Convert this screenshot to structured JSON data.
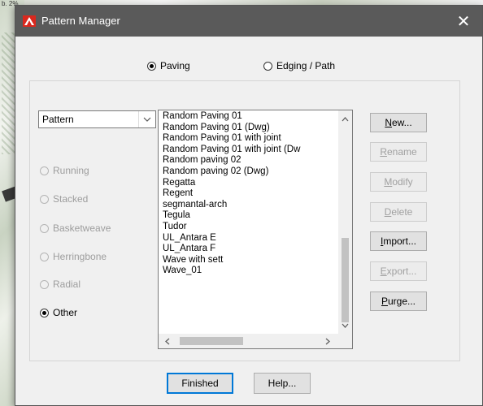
{
  "background": {
    "corner_text": "b. 2%"
  },
  "window": {
    "title": "Pattern Manager",
    "close_glyph": "✕"
  },
  "mode": {
    "paving_label": "Paving",
    "edging_label": "Edging / Path",
    "selected": "paving"
  },
  "pattern_type": {
    "selected": "Pattern"
  },
  "layouts": [
    {
      "label": "Running",
      "enabled": false,
      "checked": false
    },
    {
      "label": "Stacked",
      "enabled": false,
      "checked": false
    },
    {
      "label": "Basketweave",
      "enabled": false,
      "checked": false
    },
    {
      "label": "Herringbone",
      "enabled": false,
      "checked": false
    },
    {
      "label": "Radial",
      "enabled": false,
      "checked": false
    },
    {
      "label": "Other",
      "enabled": true,
      "checked": true
    }
  ],
  "patterns": [
    "Random Paving 01",
    "Random Paving 01  (Dwg)",
    "Random Paving 01 with joint",
    "Random Paving 01 with joint  (Dw",
    "Random paving 02",
    "Random paving 02  (Dwg)",
    "Regatta",
    "Regent",
    "segmantal-arch",
    "Tegula",
    "Tudor",
    "UL_Antara E",
    "UL_Antara F",
    "Wave with sett",
    "Wave_01"
  ],
  "side_buttons": [
    {
      "first": "N",
      "rest": "ew...",
      "enabled": true
    },
    {
      "first": "R",
      "rest": "ename",
      "enabled": false
    },
    {
      "first": "M",
      "rest": "odify",
      "enabled": false
    },
    {
      "first": "D",
      "rest": "elete",
      "enabled": false
    },
    {
      "first": "I",
      "rest": "mport...",
      "enabled": true
    },
    {
      "first": "E",
      "rest": "xport...",
      "enabled": false
    },
    {
      "first": "P",
      "rest": "urge...",
      "enabled": true
    }
  ],
  "footer": {
    "finished_label": "Finished",
    "help_label": "Help..."
  },
  "colors": {
    "titlebar": "#5a5a5a",
    "accent": "#0078d7",
    "icon_red": "#d9281e"
  },
  "icons": {
    "app": "app-logo-icon",
    "dropdown": "chevron-down-icon",
    "scroll_up": "scroll-up-icon",
    "scroll_down": "scroll-down-icon",
    "scroll_left": "scroll-left-icon",
    "scroll_right": "scroll-right-icon"
  }
}
